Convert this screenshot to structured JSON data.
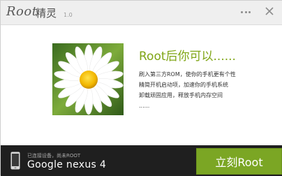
{
  "title_bar": {
    "logo": "Root",
    "name": "精灵",
    "version": "1.0"
  },
  "icons": {
    "more": "more-dots-icon",
    "close": "close-icon",
    "phone": "phone-icon"
  },
  "main": {
    "headline": "Root后你可以......",
    "description": [
      "刷入第三方ROM，使你的手机更有个性",
      "精简开机启动项，加速你的手机系统",
      "卸载顽固应用，释放手机内存空间",
      "......"
    ]
  },
  "bottom_bar": {
    "status": "已连接设备，尚未ROOT",
    "device": "Google nexus 4",
    "button": "立刻Root"
  },
  "colors": {
    "accent": "#7ba624",
    "headline": "#7fa515",
    "bottom_bar": "#1f1f1f"
  }
}
